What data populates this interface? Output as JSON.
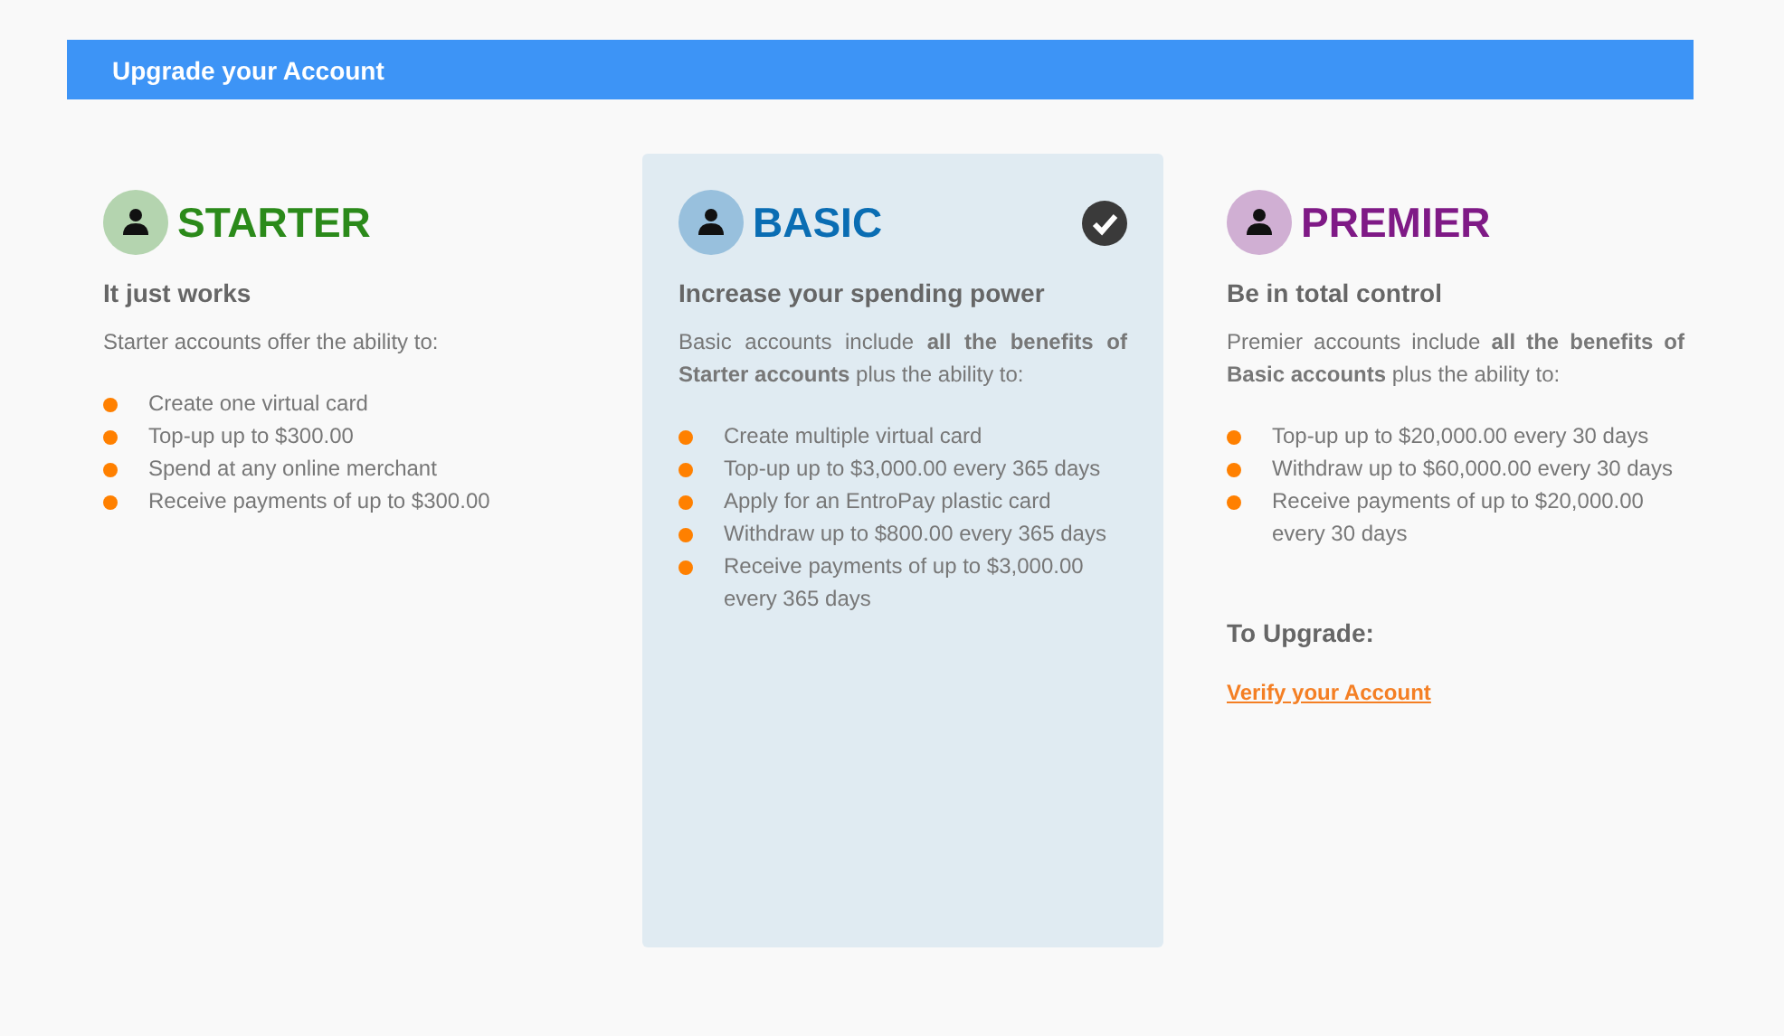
{
  "header": {
    "title": "Upgrade your Account"
  },
  "plans": [
    {
      "name": "STARTER",
      "color": "#2b8a1a",
      "selected": false,
      "tagline": "It just works",
      "description": "Starter accounts offer the ability to:",
      "features": [
        "Create one virtual card",
        "Top-up up to $300.00",
        "Spend at any online merchant",
        "Receive payments of up to $300.00"
      ]
    },
    {
      "name": "BASIC",
      "color": "#0a6db3",
      "selected": true,
      "tagline": "Increase your spending power",
      "description": "Basic accounts include **all the benefits of Starter accounts** plus the ability to:",
      "features": [
        "Create multiple virtual card",
        "Top-up up to $3,000.00 every 365 days",
        "Apply for an EntroPay plastic card",
        "Withdraw up to $800.00 every 365 days",
        "Receive payments of up to $3,000.00 every 365 days"
      ]
    },
    {
      "name": "PREMIER",
      "color": "#7f1a86",
      "selected": false,
      "tagline": "Be in total control",
      "description": "Premier accounts include **all the benefits of Basic accounts** plus the ability to:",
      "features": [
        "Top-up up to $20,000.00 every 30 days",
        "Withdraw up to $60,000.00 every 30 days",
        "Receive payments of up to $20,000.00 every 30 days"
      ],
      "upgrade": {
        "heading": "To Upgrade:",
        "link": "Verify your Account"
      }
    }
  ]
}
